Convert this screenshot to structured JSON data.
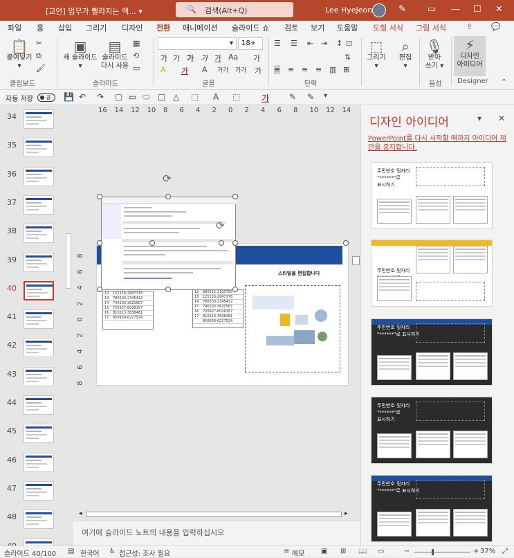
{
  "titlebar": {
    "doc_title": "[교안] 업무가 빨라지는 엑...",
    "doc_caret": "▾",
    "search_icon": "🔍",
    "search": "검색(Alt+Q)",
    "user": "Lee HyeJeong",
    "pen_icon": "✎",
    "restore_icon": "▭",
    "minimize": "—",
    "maximize": "☐",
    "close": "✕"
  },
  "menu": [
    "파일",
    "홈",
    "삽입",
    "그리기",
    "디자인",
    "전환",
    "애니메이션",
    "슬라이드 쇼",
    "검토",
    "보기",
    "도움말",
    "도형 서식",
    "그림 서식"
  ],
  "menu_active": "전환",
  "ribbon": {
    "paste": "붙여넣기",
    "paste_caret": "▾",
    "clipboard": "클립보드",
    "new_slide_1": "새 슬라이드",
    "new_slide_2": "▾",
    "reuse_1": "슬라이드",
    "reuse_2": "다시 사용",
    "slides_group": "슬라이드",
    "font_group": "글꼴",
    "para_group": "단락",
    "font_size": "18+",
    "font_caret": "▾",
    "draw": "그리기",
    "draw_caret": "▾",
    "edit": "편집",
    "edit_caret": "▾",
    "voice_1": "받아",
    "voice_2": "쓰기 ▾",
    "voice_group": "음성",
    "designer_1": "디자인",
    "designer_2": "아이디어",
    "designer_group": "Designer",
    "font_glyphs": [
      "가",
      "가",
      "가",
      "가",
      "가",
      "Aa",
      "가",
      "A",
      "가",
      "A",
      "가가",
      "가가",
      "가"
    ],
    "para_glyphs": [
      "☰",
      "☰",
      "⇤",
      "⇥",
      "↕",
      "≡",
      "≡",
      "≡",
      "≡",
      "▥",
      "⊞",
      "⇅",
      "⊡"
    ]
  },
  "qat": {
    "autosave": "자동 저장",
    "toggle": "끔",
    "glyphs": [
      "💾",
      "↶",
      "↷",
      "▢",
      "▭",
      "⬭",
      "□",
      "△",
      "⬚",
      "A",
      "⬚",
      "가",
      "✎",
      "✎",
      "▾"
    ]
  },
  "ruler_h": [
    "16",
    "14",
    "12",
    "10",
    "8",
    "6",
    "4",
    "2",
    "0",
    "2",
    "4",
    "6",
    "8",
    "10",
    "12",
    "14",
    "16"
  ],
  "ruler_v": [
    "8",
    "6",
    "4",
    "2",
    "0",
    "2",
    "4",
    "6",
    "8"
  ],
  "thumbnails": [
    {
      "num": "34"
    },
    {
      "num": "35"
    },
    {
      "num": "36"
    },
    {
      "num": "37"
    },
    {
      "num": "38"
    },
    {
      "num": "39"
    },
    {
      "num": "40",
      "selected": true
    },
    {
      "num": "41"
    },
    {
      "num": "42"
    },
    {
      "num": "43"
    },
    {
      "num": "44"
    },
    {
      "num": "45"
    },
    {
      "num": "46"
    },
    {
      "num": "47"
    },
    {
      "num": "48"
    },
    {
      "num": "49"
    }
  ],
  "slide": {
    "caption": "스타일을 편집합니다",
    "rows_left": [
      "12",
      "13",
      "14",
      "15",
      "16",
      "17"
    ],
    "values_left": [
      "121116-2847176",
      "780530-2345412",
      "740103-3620587",
      "720927-8028157",
      "810213-3838481",
      "850930-6227524"
    ],
    "rows_right": [
      "12",
      "13",
      "14",
      "15",
      "16",
      "17"
    ],
    "values_right": [
      "880515-2100795",
      "121116-2847176",
      "780530-2345412",
      "740103-3620587",
      "720927-8028157",
      "810213-3838481",
      "850930-6227524"
    ]
  },
  "notes_placeholder": "여기에 슬라이드 노트의 내용을 입력하십시오",
  "panel": {
    "title": "디자인 아이디어",
    "close": "✕",
    "menu": "▾",
    "link": "PowerPoint를 다시 시작할 때까지 아이디어 제안을 중지합니다.",
    "ideas": [
      {
        "line1": "주민번호 뒷자리",
        "line2": "\"******\"로",
        "line3": "표시하기",
        "theme": "light",
        "accent": "#ffffff"
      },
      {
        "line1": "주민번호 뒷자리",
        "line2": "\"******\"로",
        "line3": "표시하기",
        "theme": "light-yellow",
        "accent": "#f2b824"
      },
      {
        "line1": "주민번호 뒷자리",
        "line2": "\"******\"로 표시하기",
        "line3": "",
        "theme": "dark",
        "accent": "#1f4e9e"
      },
      {
        "line1": "주민번호 뒷자리",
        "line2": "\"******\"로",
        "line3": "표시하기",
        "theme": "dark",
        "accent": "#2a2a2a"
      },
      {
        "line1": "주민번호 뒷자리",
        "line2": "\"******\"로 표시하기",
        "line3": "",
        "theme": "dark-blue",
        "accent": "#1f4e9e"
      }
    ]
  },
  "status": {
    "slide": "슬라이드 40/100",
    "lang": "한국어",
    "access": "접근성: 조사 필요",
    "notes": "메모",
    "zoom": "37%",
    "minus": "−",
    "plus": "+"
  },
  "colors": {
    "accent": "#b7472a",
    "header_blue": "#1f4e9e",
    "link_red": "#c0392b"
  }
}
